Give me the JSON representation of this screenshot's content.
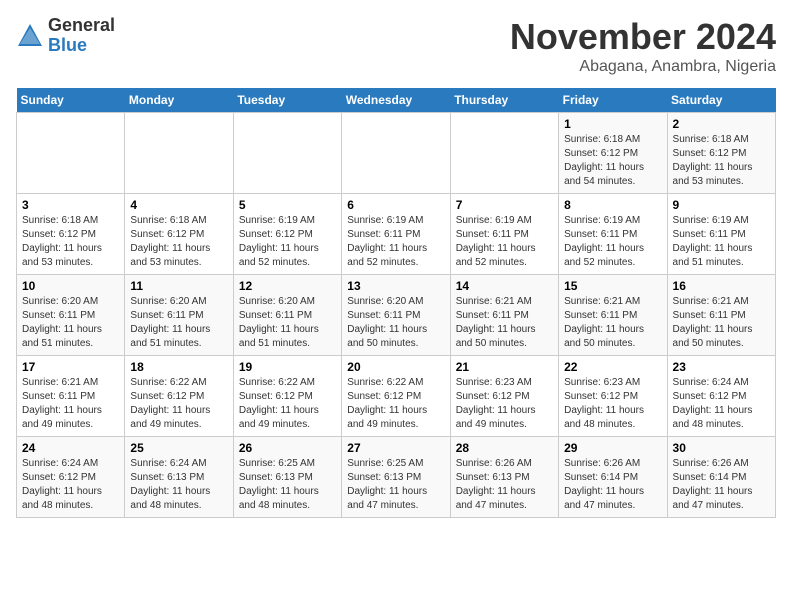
{
  "logo": {
    "general": "General",
    "blue": "Blue"
  },
  "title": "November 2024",
  "subtitle": "Abagana, Anambra, Nigeria",
  "days_of_week": [
    "Sunday",
    "Monday",
    "Tuesday",
    "Wednesday",
    "Thursday",
    "Friday",
    "Saturday"
  ],
  "weeks": [
    [
      {
        "day": "",
        "info": ""
      },
      {
        "day": "",
        "info": ""
      },
      {
        "day": "",
        "info": ""
      },
      {
        "day": "",
        "info": ""
      },
      {
        "day": "",
        "info": ""
      },
      {
        "day": "1",
        "info": "Sunrise: 6:18 AM\nSunset: 6:12 PM\nDaylight: 11 hours\nand 54 minutes."
      },
      {
        "day": "2",
        "info": "Sunrise: 6:18 AM\nSunset: 6:12 PM\nDaylight: 11 hours\nand 53 minutes."
      }
    ],
    [
      {
        "day": "3",
        "info": "Sunrise: 6:18 AM\nSunset: 6:12 PM\nDaylight: 11 hours\nand 53 minutes."
      },
      {
        "day": "4",
        "info": "Sunrise: 6:18 AM\nSunset: 6:12 PM\nDaylight: 11 hours\nand 53 minutes."
      },
      {
        "day": "5",
        "info": "Sunrise: 6:19 AM\nSunset: 6:12 PM\nDaylight: 11 hours\nand 52 minutes."
      },
      {
        "day": "6",
        "info": "Sunrise: 6:19 AM\nSunset: 6:11 PM\nDaylight: 11 hours\nand 52 minutes."
      },
      {
        "day": "7",
        "info": "Sunrise: 6:19 AM\nSunset: 6:11 PM\nDaylight: 11 hours\nand 52 minutes."
      },
      {
        "day": "8",
        "info": "Sunrise: 6:19 AM\nSunset: 6:11 PM\nDaylight: 11 hours\nand 52 minutes."
      },
      {
        "day": "9",
        "info": "Sunrise: 6:19 AM\nSunset: 6:11 PM\nDaylight: 11 hours\nand 51 minutes."
      }
    ],
    [
      {
        "day": "10",
        "info": "Sunrise: 6:20 AM\nSunset: 6:11 PM\nDaylight: 11 hours\nand 51 minutes."
      },
      {
        "day": "11",
        "info": "Sunrise: 6:20 AM\nSunset: 6:11 PM\nDaylight: 11 hours\nand 51 minutes."
      },
      {
        "day": "12",
        "info": "Sunrise: 6:20 AM\nSunset: 6:11 PM\nDaylight: 11 hours\nand 51 minutes."
      },
      {
        "day": "13",
        "info": "Sunrise: 6:20 AM\nSunset: 6:11 PM\nDaylight: 11 hours\nand 50 minutes."
      },
      {
        "day": "14",
        "info": "Sunrise: 6:21 AM\nSunset: 6:11 PM\nDaylight: 11 hours\nand 50 minutes."
      },
      {
        "day": "15",
        "info": "Sunrise: 6:21 AM\nSunset: 6:11 PM\nDaylight: 11 hours\nand 50 minutes."
      },
      {
        "day": "16",
        "info": "Sunrise: 6:21 AM\nSunset: 6:11 PM\nDaylight: 11 hours\nand 50 minutes."
      }
    ],
    [
      {
        "day": "17",
        "info": "Sunrise: 6:21 AM\nSunset: 6:11 PM\nDaylight: 11 hours\nand 49 minutes."
      },
      {
        "day": "18",
        "info": "Sunrise: 6:22 AM\nSunset: 6:12 PM\nDaylight: 11 hours\nand 49 minutes."
      },
      {
        "day": "19",
        "info": "Sunrise: 6:22 AM\nSunset: 6:12 PM\nDaylight: 11 hours\nand 49 minutes."
      },
      {
        "day": "20",
        "info": "Sunrise: 6:22 AM\nSunset: 6:12 PM\nDaylight: 11 hours\nand 49 minutes."
      },
      {
        "day": "21",
        "info": "Sunrise: 6:23 AM\nSunset: 6:12 PM\nDaylight: 11 hours\nand 49 minutes."
      },
      {
        "day": "22",
        "info": "Sunrise: 6:23 AM\nSunset: 6:12 PM\nDaylight: 11 hours\nand 48 minutes."
      },
      {
        "day": "23",
        "info": "Sunrise: 6:24 AM\nSunset: 6:12 PM\nDaylight: 11 hours\nand 48 minutes."
      }
    ],
    [
      {
        "day": "24",
        "info": "Sunrise: 6:24 AM\nSunset: 6:12 PM\nDaylight: 11 hours\nand 48 minutes."
      },
      {
        "day": "25",
        "info": "Sunrise: 6:24 AM\nSunset: 6:13 PM\nDaylight: 11 hours\nand 48 minutes."
      },
      {
        "day": "26",
        "info": "Sunrise: 6:25 AM\nSunset: 6:13 PM\nDaylight: 11 hours\nand 48 minutes."
      },
      {
        "day": "27",
        "info": "Sunrise: 6:25 AM\nSunset: 6:13 PM\nDaylight: 11 hours\nand 47 minutes."
      },
      {
        "day": "28",
        "info": "Sunrise: 6:26 AM\nSunset: 6:13 PM\nDaylight: 11 hours\nand 47 minutes."
      },
      {
        "day": "29",
        "info": "Sunrise: 6:26 AM\nSunset: 6:14 PM\nDaylight: 11 hours\nand 47 minutes."
      },
      {
        "day": "30",
        "info": "Sunrise: 6:26 AM\nSunset: 6:14 PM\nDaylight: 11 hours\nand 47 minutes."
      }
    ]
  ]
}
